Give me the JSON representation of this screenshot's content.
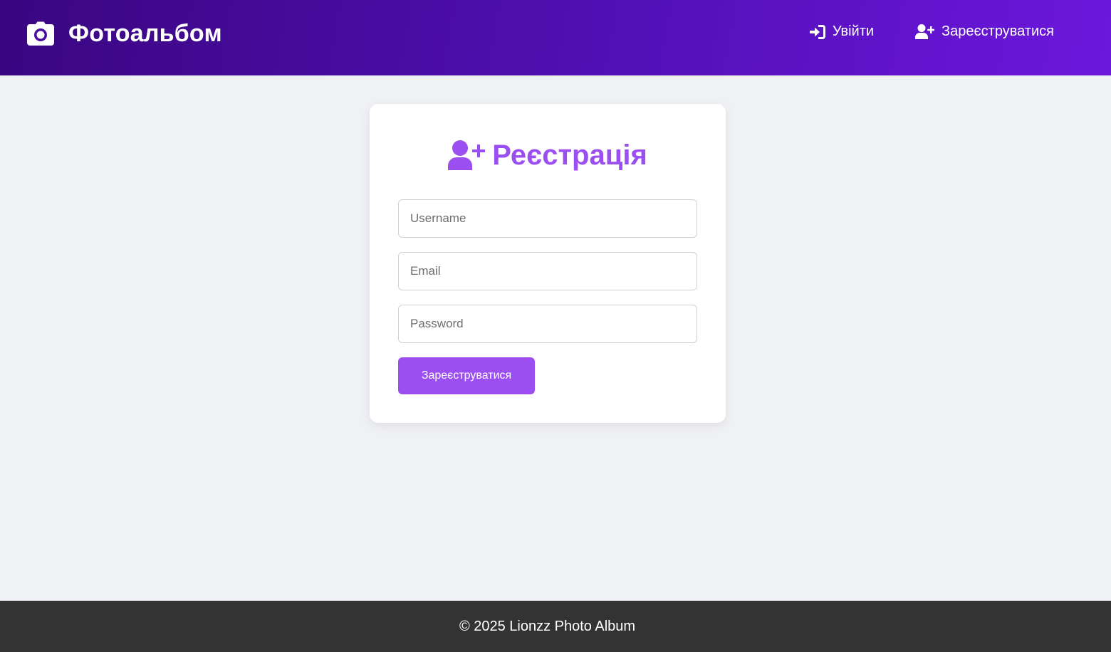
{
  "header": {
    "brand": "Фотоальбом",
    "brand_icon": "camera-icon",
    "nav": {
      "login_label": "Увійти",
      "login_icon": "sign-in-icon",
      "register_label": "Зареєструватися",
      "register_icon": "user-plus-icon"
    }
  },
  "form": {
    "title": "Реєстрація",
    "title_icon": "user-plus-icon",
    "username": {
      "placeholder": "Username",
      "value": ""
    },
    "email": {
      "placeholder": "Email",
      "value": ""
    },
    "password": {
      "placeholder": "Password",
      "value": ""
    },
    "submit_label": "Зареєструватися"
  },
  "footer": {
    "text": "© 2025 Lionzz Photo Album"
  },
  "colors": {
    "header_gradient_start": "#3a0680",
    "header_gradient_end": "#6c17dc",
    "accent": "#9b4ff0",
    "page_background": "#f0f1f5",
    "footer_background": "#333333"
  }
}
